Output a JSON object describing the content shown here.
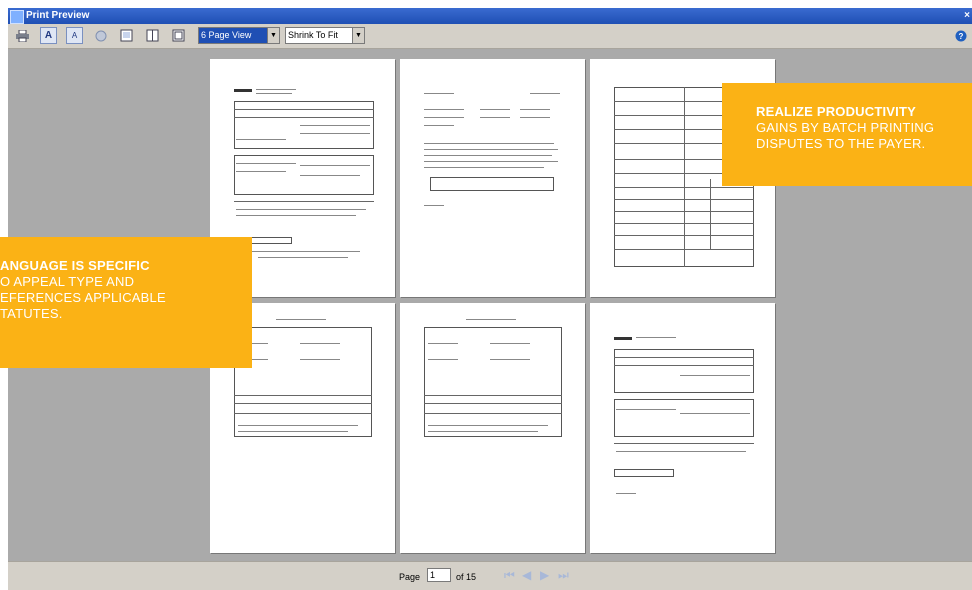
{
  "window": {
    "title": "Print Preview",
    "close": "×"
  },
  "toolbar": {
    "view_select": "6 Page View",
    "fit_select": "Shrink To Fit",
    "icons": [
      "printer-icon",
      "font-large-icon",
      "font-small-icon",
      "help-circle-icon",
      "single-page-icon",
      "two-page-icon",
      "fit-page-icon",
      "help-icon"
    ]
  },
  "status": {
    "page_label": "Page",
    "page_value": "1",
    "of_label": "of 15"
  },
  "callouts": {
    "left": {
      "heading": "ANGUAGE IS SPECIFIC",
      "lines": [
        "O APPEAL TYPE AND",
        "EFERENCES APPLICABLE",
        "TATUTES."
      ]
    },
    "right": {
      "heading": "REALIZE PRODUCTIVITY",
      "lines": [
        "GAINS BY BATCH PRINTING",
        "DISPUTES TO THE PAYER."
      ]
    }
  },
  "colors": {
    "callout": "#fbb215",
    "preview_bg": "#aaaaaa",
    "titlebar": "#1f4fb4"
  }
}
